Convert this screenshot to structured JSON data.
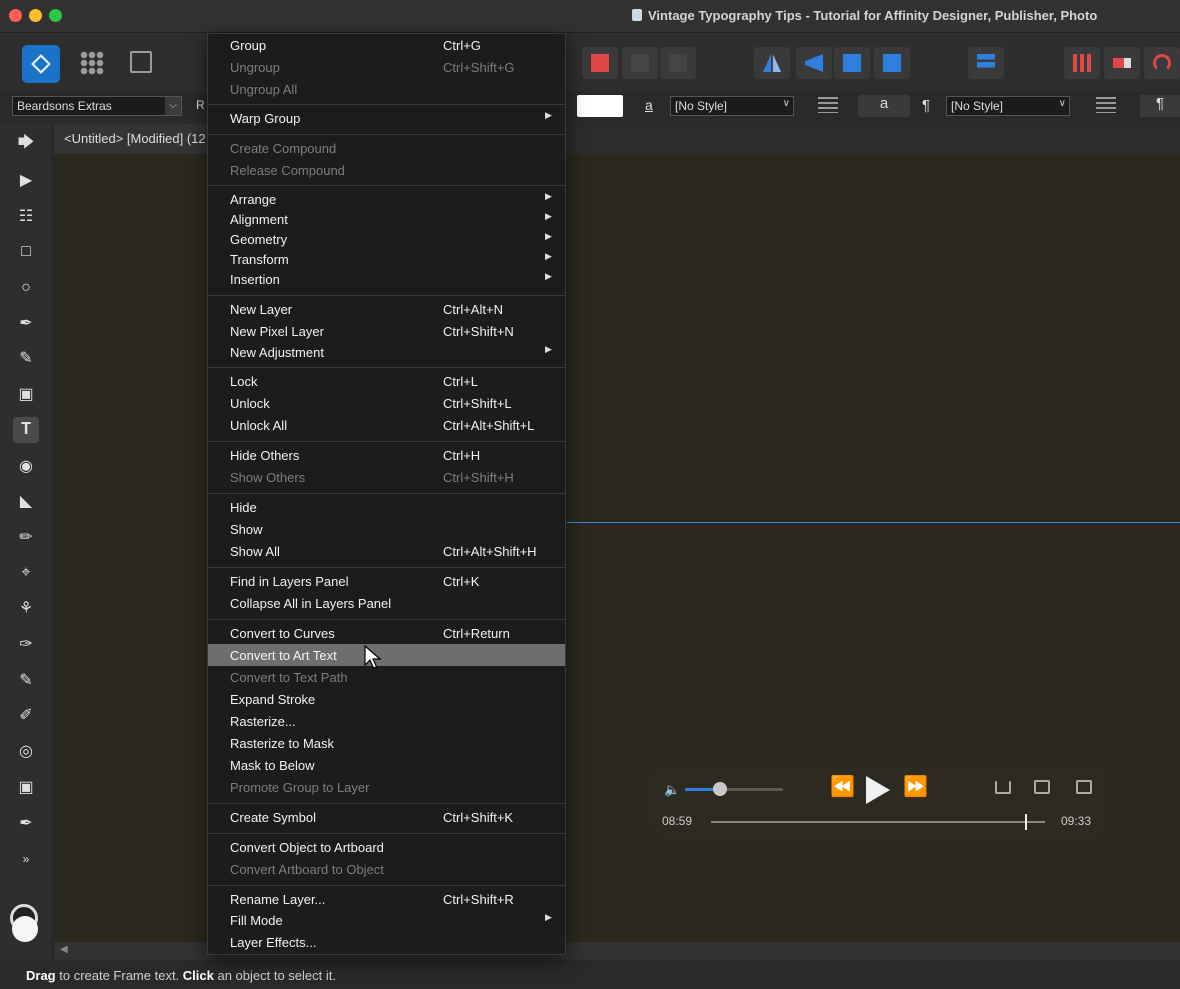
{
  "window": {
    "title": "Vintage Typography Tips - Tutorial for Affinity Designer, Publisher, Photo"
  },
  "context_toolbar": {
    "font_name": "Beardsons Extras",
    "font_style_partial": "R",
    "underline_glyph": "a",
    "paragraph_style": "[No Style]",
    "character_glyph": "a",
    "pilcrow": "¶",
    "character_style": "[No Style]"
  },
  "document": {
    "tab_label": "<Untitled> [Modified] (12"
  },
  "context_menu": {
    "items": [
      {
        "label": "Group",
        "shortcut": "Ctrl+G",
        "enabled": true
      },
      {
        "label": "Ungroup",
        "shortcut": "Ctrl+Shift+G",
        "enabled": false
      },
      {
        "label": "Ungroup All",
        "shortcut": "",
        "enabled": false
      },
      {
        "label": "Warp Group",
        "shortcut": "",
        "enabled": true,
        "submenu": true
      },
      {
        "label": "Create Compound",
        "shortcut": "",
        "enabled": false
      },
      {
        "label": "Release Compound",
        "shortcut": "",
        "enabled": false
      },
      {
        "label": "Arrange",
        "shortcut": "",
        "enabled": true,
        "submenu": true
      },
      {
        "label": "Alignment",
        "shortcut": "",
        "enabled": true,
        "submenu": true
      },
      {
        "label": "Geometry",
        "shortcut": "",
        "enabled": true,
        "submenu": true
      },
      {
        "label": "Transform",
        "shortcut": "",
        "enabled": true,
        "submenu": true
      },
      {
        "label": "Insertion",
        "shortcut": "",
        "enabled": true,
        "submenu": true
      },
      {
        "label": "New Layer",
        "shortcut": "Ctrl+Alt+N",
        "enabled": true
      },
      {
        "label": "New Pixel Layer",
        "shortcut": "Ctrl+Shift+N",
        "enabled": true
      },
      {
        "label": "New Adjustment",
        "shortcut": "",
        "enabled": true,
        "submenu": true
      },
      {
        "label": "Lock",
        "shortcut": "Ctrl+L",
        "enabled": true
      },
      {
        "label": "Unlock",
        "shortcut": "Ctrl+Shift+L",
        "enabled": true
      },
      {
        "label": "Unlock All",
        "shortcut": "Ctrl+Alt+Shift+L",
        "enabled": true
      },
      {
        "label": "Hide Others",
        "shortcut": "Ctrl+H",
        "enabled": true
      },
      {
        "label": "Show Others",
        "shortcut": "Ctrl+Shift+H",
        "enabled": false
      },
      {
        "label": "Hide",
        "shortcut": "",
        "enabled": true
      },
      {
        "label": "Show",
        "shortcut": "",
        "enabled": true
      },
      {
        "label": "Show All",
        "shortcut": "Ctrl+Alt+Shift+H",
        "enabled": true
      },
      {
        "label": "Find in Layers Panel",
        "shortcut": "Ctrl+K",
        "enabled": true
      },
      {
        "label": "Collapse All in Layers Panel",
        "shortcut": "",
        "enabled": true
      },
      {
        "label": "Convert to Curves",
        "shortcut": "Ctrl+Return",
        "enabled": true
      },
      {
        "label": "Convert to Art Text",
        "shortcut": "",
        "enabled": true,
        "highlighted": true
      },
      {
        "label": "Convert to Text Path",
        "shortcut": "",
        "enabled": false
      },
      {
        "label": "Expand Stroke",
        "shortcut": "",
        "enabled": true
      },
      {
        "label": "Rasterize...",
        "shortcut": "",
        "enabled": true
      },
      {
        "label": "Rasterize to Mask",
        "shortcut": "",
        "enabled": true
      },
      {
        "label": "Mask to Below",
        "shortcut": "",
        "enabled": true
      },
      {
        "label": "Promote Group to Layer",
        "shortcut": "",
        "enabled": false
      },
      {
        "label": "Create Symbol",
        "shortcut": "Ctrl+Shift+K",
        "enabled": true
      },
      {
        "label": "Convert Object to Artboard",
        "shortcut": "",
        "enabled": true
      },
      {
        "label": "Convert Artboard to Object",
        "shortcut": "",
        "enabled": false
      },
      {
        "label": "Rename Layer...",
        "shortcut": "Ctrl+Shift+R",
        "enabled": true
      },
      {
        "label": "Fill Mode",
        "shortcut": "",
        "enabled": true,
        "submenu": true
      },
      {
        "label": "Layer Effects...",
        "shortcut": "",
        "enabled": true
      }
    ]
  },
  "video_player": {
    "current_time": "08:59",
    "total_time": "09:33",
    "volume_fraction": 0.36,
    "progress_fraction": 0.94
  },
  "status": {
    "bold1": "Drag",
    "text1": " to create Frame text. ",
    "bold2": "Click",
    "text2": " an object to select it."
  },
  "colors": {
    "accent_blue": "#3c88d9",
    "menu_bg": "#1c1c1c",
    "menu_highlight": "#6e6e6e",
    "canvas": "#2b291e"
  }
}
